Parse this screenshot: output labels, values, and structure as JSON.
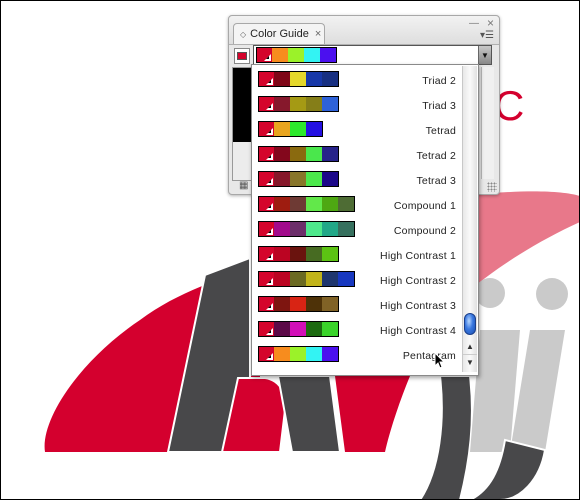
{
  "panel": {
    "tab_label": "Color Guide",
    "tab_arrows_icon": "◇",
    "tab_close_icon": "×",
    "minimize_icon": "—",
    "close_icon": "×",
    "menu_icon": "▾☰",
    "base_color": "#d4042c",
    "selected_harmony": {
      "name": "Pentagram",
      "colors": [
        "#f78c1e",
        "#9bf229",
        "#33f3f3",
        "#4b10ef"
      ]
    },
    "dropdown_arrow_icon": "▼",
    "grid_icon": "▦"
  },
  "harmony_menu": {
    "items": [
      {
        "label": "Triad 2",
        "colors": [
          "#7f0718",
          "#e5d82b",
          "#1838a8",
          "#183082"
        ]
      },
      {
        "label": "Triad 3",
        "colors": [
          "#86182c",
          "#a59a14",
          "#857e18",
          "#2e62d8"
        ]
      },
      {
        "label": "Tetrad",
        "colors": [
          "#e8a51f",
          "#2ce92c",
          "#2410e2"
        ]
      },
      {
        "label": "Tetrad 2",
        "colors": [
          "#83071c",
          "#8a6a0f",
          "#4ae74c",
          "#27238a"
        ]
      },
      {
        "label": "Tetrad 3",
        "colors": [
          "#86182a",
          "#88762a",
          "#4ce84c",
          "#1c0889"
        ]
      },
      {
        "label": "Compound 1",
        "colors": [
          "#9e1c10",
          "#6e3a34",
          "#62e84a",
          "#4ea812",
          "#4e6c34"
        ]
      },
      {
        "label": "Compound 2",
        "colors": [
          "#a20b8c",
          "#6c2e6a",
          "#4ee88c",
          "#22a888",
          "#36705e"
        ]
      },
      {
        "label": "High Contrast 1",
        "colors": [
          "#bb0422",
          "#6a130e",
          "#476b22",
          "#5cc313"
        ]
      },
      {
        "label": "High Contrast 2",
        "colors": [
          "#bb0422",
          "#6b6a22",
          "#c2b41a",
          "#1f366e",
          "#1838c0"
        ]
      },
      {
        "label": "High Contrast 3",
        "colors": [
          "#7e1510",
          "#d82414",
          "#4e3208",
          "#806226"
        ]
      },
      {
        "label": "High Contrast 4",
        "colors": [
          "#5c0a48",
          "#d20fb8",
          "#1c6a10",
          "#3ad42a"
        ]
      },
      {
        "label": "Pentagram",
        "colors": [
          "#f78c1e",
          "#9bf229",
          "#33f3f3",
          "#4b10ef"
        ]
      }
    ],
    "scroll_up_icon": "▲",
    "scroll_down_icon": "▼",
    "scroll_position": 0.92
  },
  "artwork": {
    "red": "#d4002e",
    "pink": "#e8788a",
    "dark_grey": "#48484a",
    "light_grey": "#cacaca",
    "letter_c": "C"
  }
}
